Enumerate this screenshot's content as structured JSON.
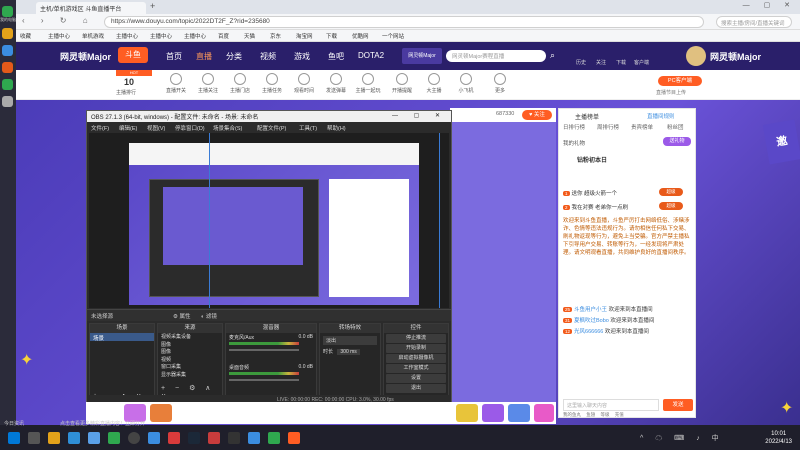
{
  "left_strip": {
    "items": [
      {
        "label": "我的电脑"
      },
      {
        "label": ""
      },
      {
        "label": ""
      },
      {
        "label": ""
      },
      {
        "label": ""
      },
      {
        "label": ""
      }
    ]
  },
  "browser": {
    "tab1_title": "主机/单机游戏区 斗鱼直播平台",
    "new_tab": "+",
    "url": "https://www.douyu.com/topic/2022DT2F_Z?rid=235680",
    "search_placeholder": "搜索主播/房间/直播关键词",
    "bookmarks": [
      "收藏",
      "主播中心",
      "单机游戏",
      "主播中心",
      "主播中心",
      "主播中心",
      "百度",
      "天猫",
      "京东",
      "淘宝网",
      "下载",
      "优酷网",
      "一个网站"
    ]
  },
  "site": {
    "logo_text": "网灵顿Major",
    "brand": "斗鱼",
    "nav": [
      "首页",
      "直播",
      "分类",
      "视频",
      "游戏",
      "鱼吧",
      "DOTA2"
    ],
    "search_placeholder": "网灵顿Major赛程直播",
    "header_icons": [
      "历史",
      "关注",
      "下载",
      "客户端",
      "我"
    ],
    "ad_banner": "网灵顿Major"
  },
  "categories": {
    "rank_label": "主播排行",
    "rank_num": "10",
    "items": [
      "直播开关",
      "主播关注",
      "主播门店",
      "主播任务",
      "观看时间",
      "发送弹幕",
      "主播一起玩",
      "开播提醒",
      "大主播",
      "小飞机",
      "更多"
    ],
    "pc_client": "PC客户端",
    "upload_note": "直播节目上传"
  },
  "stream": {
    "follow_label": "关注",
    "viewer_count": "687330"
  },
  "obs": {
    "title": "OBS 27.1.3 (64-bit, windows) - 配置文件: 未命名 - 场景: 未命名",
    "menu": [
      "文件(F)",
      "编辑(E)",
      "视图(V)",
      "停靠窗口(D)",
      "场景集合(S)",
      "配置文件(P)",
      "工具(T)",
      "帮助(H)"
    ],
    "scene_label": "未选择源",
    "properties_btn": "属性",
    "filters_btn": "滤镜",
    "docks": {
      "scenes": "场景",
      "sources": "来源",
      "mixer": "混音器",
      "transitions": "转场特效",
      "controls": "控件"
    },
    "scene_item": "场景",
    "sources": [
      "视频采集设备",
      "图像",
      "图像",
      "视频",
      "窗口采集",
      "显示器采集"
    ],
    "mixer_tracks": [
      {
        "name": "麦克风/Aux",
        "db": "0.0 dB"
      },
      {
        "name": "桌面音频",
        "db": "0.0 dB"
      }
    ],
    "transition_value": "淡出",
    "duration_label": "时长",
    "duration_value": "300 ms",
    "controls": [
      "停止推流",
      "开始录制",
      "启动虚拟摄像机",
      "工作室模式",
      "设置",
      "退出"
    ],
    "status": "LIVE: 00:00:00   REC: 00:00:00   CPU: 3.0%, 30.00 fps"
  },
  "chat": {
    "top_label": "主播榜单",
    "top_right": "直播间规则",
    "tabs": [
      "日排行榜",
      "周排行榜",
      "贵宾榜单",
      "粉丝团"
    ],
    "gift_label": "我的礼物",
    "gift_btn": "送礼物",
    "user_badge": "钻粉初本日",
    "rank_entries": [
      {
        "rank": "1",
        "text": "送你 超级火箭一个",
        "badge": "超级"
      },
      {
        "rank": "2",
        "text": "我在对赛 老弟你一点刷",
        "badge": "超级"
      }
    ],
    "system_msg": "欢迎来到斗鱼直播，斗鱼严厉打击网络低俗、涉赌涉诈、色情等违法违规行为。请勿相信任何私下交易、刷礼物返现等行为，避免上当受骗。官方严禁主播私下引导用户交易、转账等行为，一经发现将严肃处理。请文明观看直播，共同维护良好的直播间秩序。",
    "messages": [
      {
        "lv": "25",
        "user": "斗鱼用户小王",
        "text": "欢迎来到本直播间"
      },
      {
        "lv": "31",
        "user": "夏枫吹过Bobo",
        "text": "欢迎来到本直播间"
      },
      {
        "lv": "12",
        "user": "光风666666",
        "text": "欢迎来到本直播间"
      }
    ],
    "input_placeholder": "这里输入聊天内容",
    "send_btn": "发送",
    "bottom_links": [
      "我的鱼丸",
      "鱼翅",
      "等级",
      "充值"
    ]
  },
  "taskbar": {
    "notification": "今日资讯",
    "running": "点击查看更多精彩直播内容！立即打开",
    "time": "10:01",
    "date": "2022/4/13"
  },
  "colors": {
    "brand_orange": "#ff5d23",
    "site_purple": "#2a1f6a",
    "obs_dark": "#2b2b2b"
  }
}
